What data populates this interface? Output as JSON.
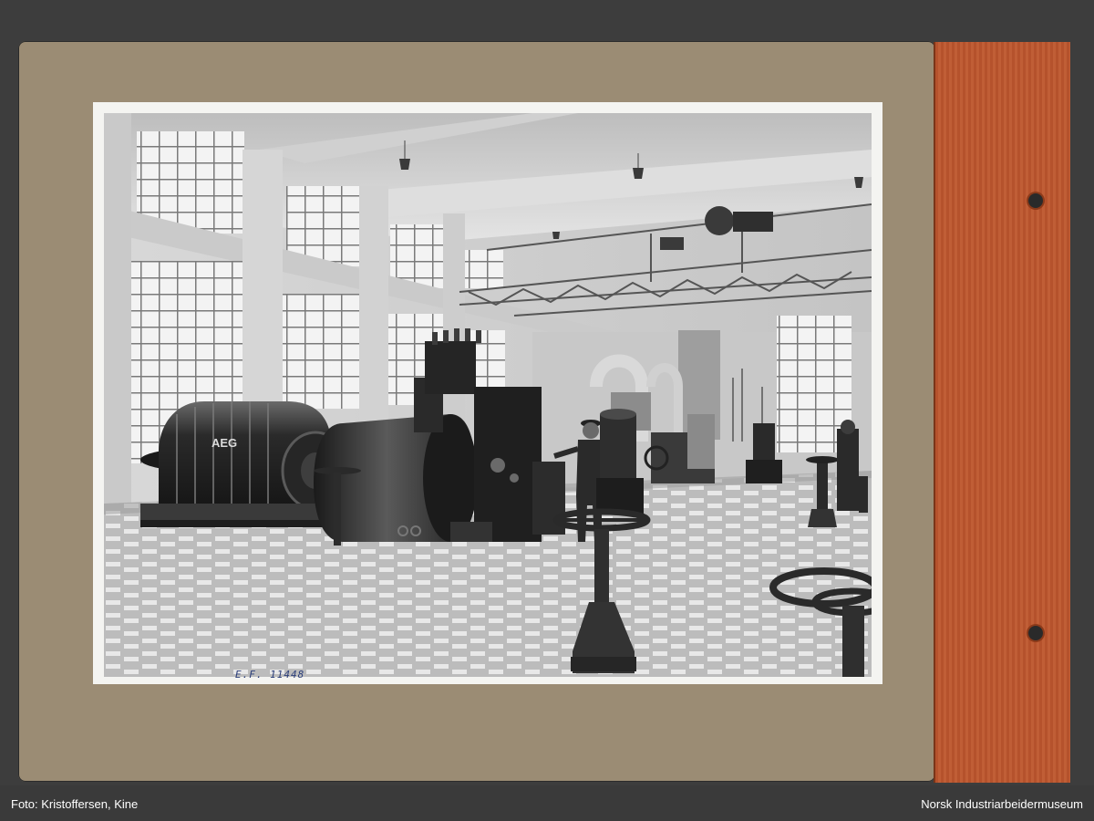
{
  "photo_credit": "Foto: Kristoffersen, Kine",
  "museum": "Norsk Industriarbeidermuseum",
  "catalog_number": "E.F. 11448",
  "generator_marking": "AEG"
}
